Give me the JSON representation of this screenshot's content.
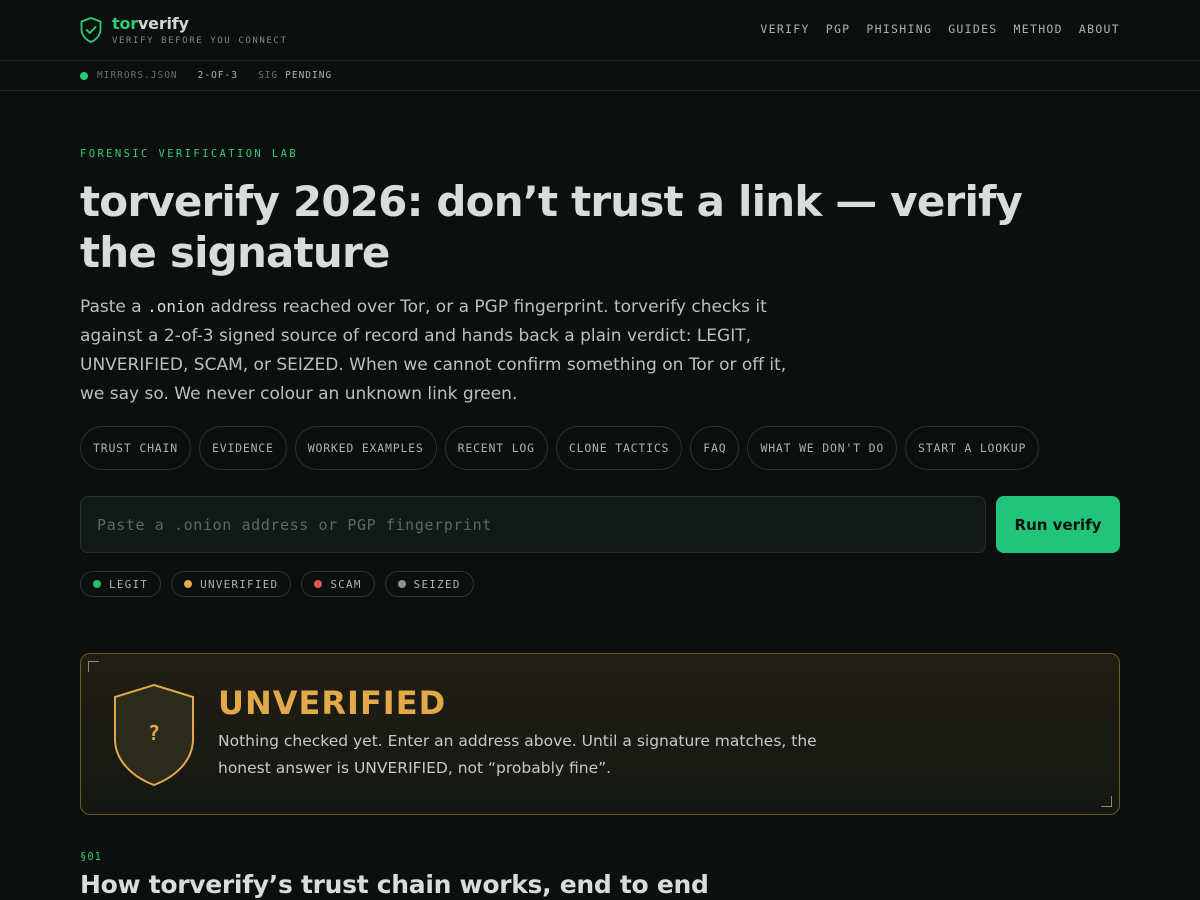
{
  "brand": {
    "name_accent": "tor",
    "name_rest": "verify",
    "tagline": "VERIFY BEFORE YOU CONNECT"
  },
  "nav": [
    "VERIFY",
    "PGP",
    "PHISHING",
    "GUIDES",
    "METHOD",
    "ABOUT"
  ],
  "status": {
    "source": "MIRRORS.JSON",
    "quorum": "2-OF-3",
    "sig_label": "SIG",
    "sig_value": "PENDING"
  },
  "hero": {
    "eyebrow": "FORENSIC VERIFICATION LAB",
    "title": "torverify 2026: don’t trust a link — verify the signature",
    "lede_before": "Paste a ",
    "lede_code": ".onion",
    "lede_after": " address reached over Tor, or a PGP fingerprint. torverify checks it against a 2-of-3 signed source of record and hands back a plain verdict: LEGIT, UNVERIFIED, SCAM, or SEIZED. When we cannot confirm something on Tor or off it, we say so. We never colour an unknown link green."
  },
  "pills": [
    "TRUST CHAIN",
    "EVIDENCE",
    "WORKED EXAMPLES",
    "RECENT LOG",
    "CLONE TACTICS",
    "FAQ",
    "WHAT WE DON'T DO",
    "START A LOOKUP"
  ],
  "search": {
    "placeholder": "Paste a .onion address or PGP fingerprint",
    "value": "",
    "button": "Run verify"
  },
  "legend": [
    {
      "label": "LEGIT",
      "color": "#22c06e"
    },
    {
      "label": "UNVERIFIED",
      "color": "#e3a948"
    },
    {
      "label": "SCAM",
      "color": "#e0524b"
    },
    {
      "label": "SEIZED",
      "color": "#8b949a"
    }
  ],
  "verdict": {
    "shield_glyph": "?",
    "title": "UNVERIFIED",
    "body": "Nothing checked yet. Enter an address above. Until a signature matches, the honest answer is UNVERIFIED, not “probably fine”.",
    "color": "#e3a948"
  },
  "section": {
    "number": "§01",
    "title": "How torverify’s trust chain works, end to end"
  }
}
